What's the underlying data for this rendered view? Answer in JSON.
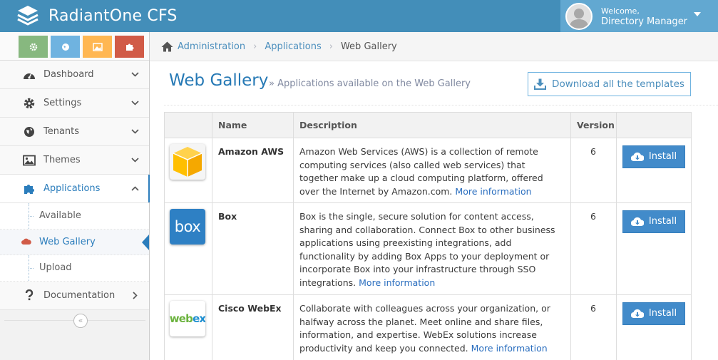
{
  "app": {
    "title": "RadiantOne CFS"
  },
  "user": {
    "welcome": "Welcome,",
    "name": "Directory Manager"
  },
  "sidebar": {
    "items": [
      {
        "label": "Dashboard"
      },
      {
        "label": "Settings"
      },
      {
        "label": "Tenants"
      },
      {
        "label": "Themes"
      },
      {
        "label": "Applications"
      },
      {
        "label": "Documentation"
      }
    ],
    "subitems": [
      {
        "label": "Available"
      },
      {
        "label": "Web Gallery"
      },
      {
        "label": "Upload"
      }
    ]
  },
  "breadcrumb": {
    "items": [
      "Administration",
      "Applications",
      "Web Gallery"
    ]
  },
  "page": {
    "title": "Web Gallery",
    "subtitle": "» Applications available on the Web Gallery",
    "download_label": "Download all the templates"
  },
  "table": {
    "headers": [
      "Name",
      "Description",
      "Version"
    ],
    "rows": [
      {
        "name": "Amazon AWS",
        "description": "Amazon Web Services (AWS) is a collection of remote computing services (also called web services) that together make up a cloud computing platform, offered over the Internet by Amazon.com.",
        "more": "More information",
        "version": "6",
        "install": "Install"
      },
      {
        "name": "Box",
        "description": "Box is the single, secure solution for content access, sharing and collaboration. Connect Box to other business applications using preexisting integrations, add functionality by adding Box Apps to your deployment or incorporate Box into your infrastructure through SSO integrations.",
        "more": "More information",
        "version": "6",
        "install": "Install"
      },
      {
        "name": "Cisco WebEx",
        "description": "Collaborate with colleagues across your organization, or halfway across the planet. Meet online and share files, information, and expertise. WebEx solutions increase productivity and keep you connected.",
        "more": "More information",
        "version": "6",
        "install": "Install"
      }
    ]
  },
  "logos": {
    "box": "box",
    "webex_web": "web",
    "webex_ex": "ex"
  },
  "colors": {
    "navbar": "#438eb9",
    "accent": "#2b7dbc",
    "install": "#428bca"
  }
}
